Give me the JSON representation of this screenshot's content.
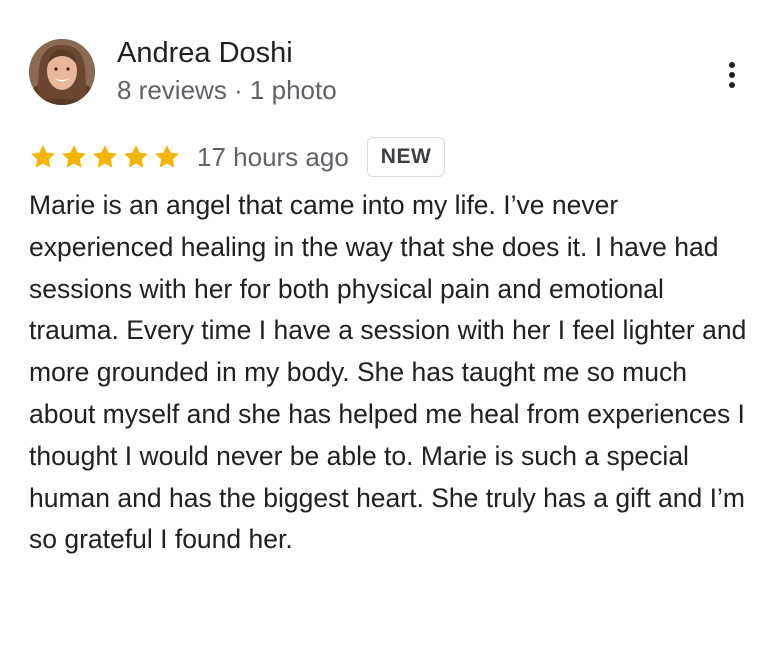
{
  "review": {
    "author": {
      "name": "Andrea Doshi",
      "meta": "8 reviews · 1 photo",
      "avatar_icon": "profile-photo"
    },
    "menu_icon": "more-vert-icon",
    "rating": {
      "stars": 5,
      "max_stars": 5,
      "star_color": "#f4b400"
    },
    "time": "17 hours ago",
    "badge": "NEW",
    "text": "Marie is an angel that came into my life. I’ve never experienced healing in the way that she does it. I have had sessions with her for both physical pain and emotional trauma. Every time I have a session with her I feel lighter and more grounded in my body. She has taught me so much about myself and she has helped me heal from experiences I thought I would never be able to. Marie is such a special human and has the biggest heart. She truly has a gift and I’m so grateful I found her."
  }
}
